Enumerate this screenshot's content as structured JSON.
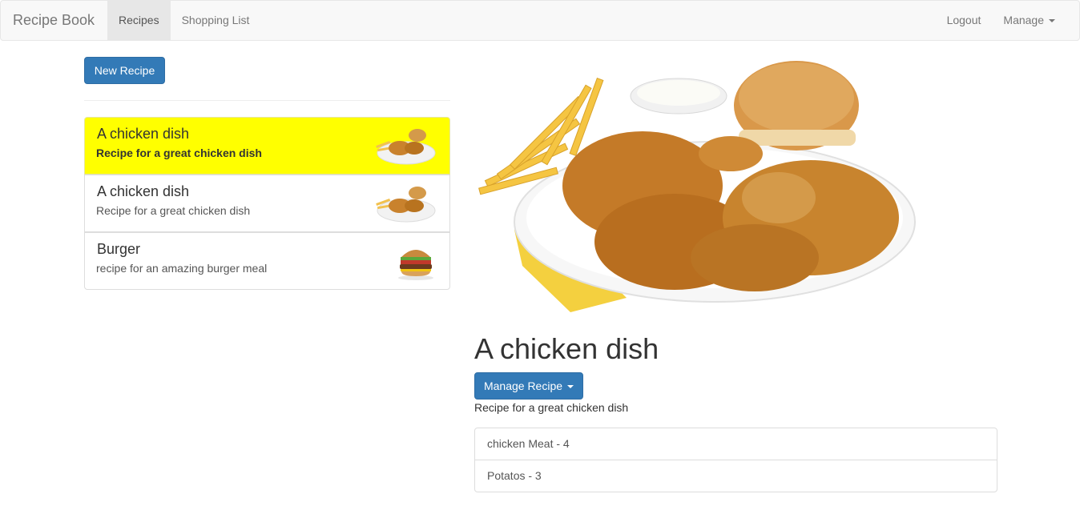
{
  "navbar": {
    "brand": "Recipe Book",
    "links": [
      "Recipes",
      "Shopping List"
    ],
    "logout": "Logout",
    "manage": "Manage"
  },
  "sidebar": {
    "new_button": "New Recipe",
    "recipes": [
      {
        "name": "A chicken dish",
        "description": "Recipe for a great chicken dish",
        "selected": true
      },
      {
        "name": "A chicken dish",
        "description": "Recipe for a great chicken dish",
        "selected": false
      },
      {
        "name": "Burger",
        "description": "recipe for an amazing burger meal",
        "selected": false
      }
    ]
  },
  "detail": {
    "title": "A chicken dish",
    "manage_button": "Manage Recipe",
    "description": "Recipe for a great chicken dish",
    "ingredients": [
      "chicken Meat - 4",
      "Potatos - 3"
    ]
  },
  "colors": {
    "brand_primary": "#337ab7",
    "selected_highlight": "#ffff00",
    "navbar_bg": "#f8f8f8"
  }
}
